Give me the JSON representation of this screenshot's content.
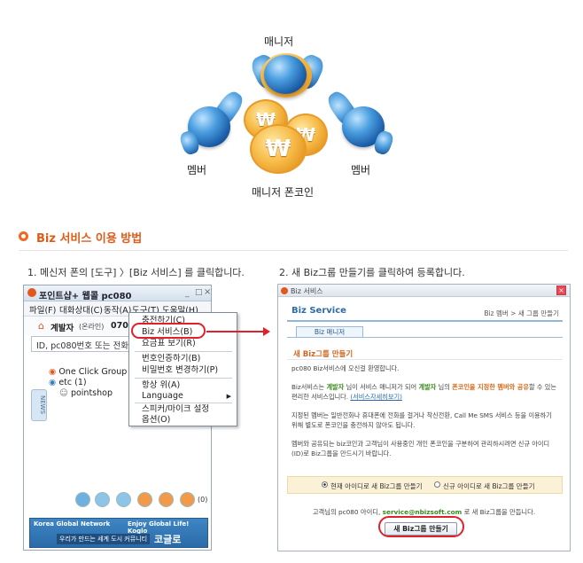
{
  "diagram": {
    "manager_label": "매니저",
    "member_left_label": "멤버",
    "member_right_label": "멤버",
    "coin_label": "매니저 폰코인",
    "coin_symbol": "₩"
  },
  "section": {
    "title": "Biz 서비스 이용 방법"
  },
  "steps": {
    "step1": "1. 메신저 폰의 [도구] 〉[Biz 서비스] 를 클릭합니다.",
    "step2": "2. 새 Biz그룹 만들기를 클릭하여 등록합니다."
  },
  "messenger": {
    "title": "포인트샵+ 웹콜 pc080",
    "menu": [
      "파일(F)",
      "대화상대(C)",
      "동작(A)",
      "도구(T)",
      "도움말(H)"
    ],
    "status_name": "계발자",
    "status_state": "(온라인)",
    "status_number": "07070",
    "search_placeholder": "ID, pc080번호 또는 전화번호",
    "tree": [
      {
        "label": "One Click Group (0)"
      },
      {
        "label": "etc (1)"
      },
      {
        "label": "pointshop"
      }
    ],
    "side_tab": "NEWS",
    "icon_count": "(0)",
    "banner_line1": "Korea Global Network",
    "banner_line1b": "Enjoy Global Life! Koglo",
    "banner_line2": "우리가 만드는 세계 도시 커뮤니티",
    "banner_brand": "코글로"
  },
  "dropdown": {
    "items": [
      "충전하기(C)",
      "Biz 서비스(B)",
      "요금표 보기(R)",
      "번호인증하기(B)",
      "비밀번호 변경하기(P)",
      "항상 위(A)",
      "Language",
      "스피커/마이크 설정",
      "옵션(O)"
    ]
  },
  "biz": {
    "window_title": "Biz 서비스",
    "brand": "Biz Service",
    "breadcrumb": "Biz 멤버 > 새 그룹 만들기",
    "tab": "Biz 매니저",
    "subtitle": "새 Biz그룹 만들기",
    "p1": "pc080 Biz서비스에 오신걸 환영합니다.",
    "p2a": "Biz서비스는 ",
    "p2_mgr": "계발자",
    "p2b": " 님이 서비스 매니저가 되어 ",
    "p2_mgr2": "계발자",
    "p2c": " 님의 ",
    "p2_hl": "폰코인을 지정한 멤버와 공유",
    "p2d": "할 수 있는 편리한 서비스입니다. ",
    "p2_link": "(서비스자세히보기)",
    "p3": "지정된 멤버는 일반전화나 휴대폰에 전화를 걸거나 착신전환, Call Me SMS 서비스 등을 이용하기 위해 별도로 폰코인을 충전하지 않아도 됩니다.",
    "p4": "멤버와 공유되는 biz코인과 고객님이 사용중인 개인 폰코인을 구분하여 관리하시려면 신규 아이디(ID)로 Biz그룹을 만드시기 바랍니다.",
    "option1": "현재 아이디로 새 Biz그룹 만들기",
    "option2": "신규 아이디로 새 Biz그룹 만들기",
    "notice_a": "고객님의 pc080 아이디, ",
    "notice_email": "service@nbizsoft.com",
    "notice_b": " 로 새 Biz그룹을 만듭니다.",
    "button": "새 Biz그룹 만들기"
  },
  "colors": {
    "accent": "#e15a17",
    "highlight": "#e0202a",
    "link": "#2d6aa6"
  }
}
